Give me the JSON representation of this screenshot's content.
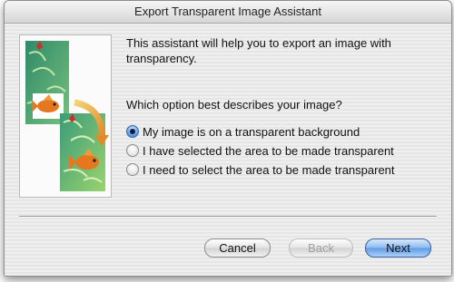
{
  "window": {
    "title": "Export Transparent Image Assistant"
  },
  "body": {
    "intro": "This assistant will help you to export an image with transparency.",
    "question": "Which option best describes your image?",
    "options": [
      {
        "label": "My image is on a transparent background",
        "selected": true
      },
      {
        "label": "I have selected the area to be made transparent",
        "selected": false
      },
      {
        "label": "I need to select the area to be made transparent",
        "selected": false
      }
    ]
  },
  "buttons": {
    "cancel": "Cancel",
    "back": "Back",
    "next": "Next"
  },
  "colors": {
    "default_button": "#6fa6ea",
    "radio_selected": "#4a86d8"
  },
  "icons": {
    "illustration": "fish-image-transparency-illustration"
  }
}
